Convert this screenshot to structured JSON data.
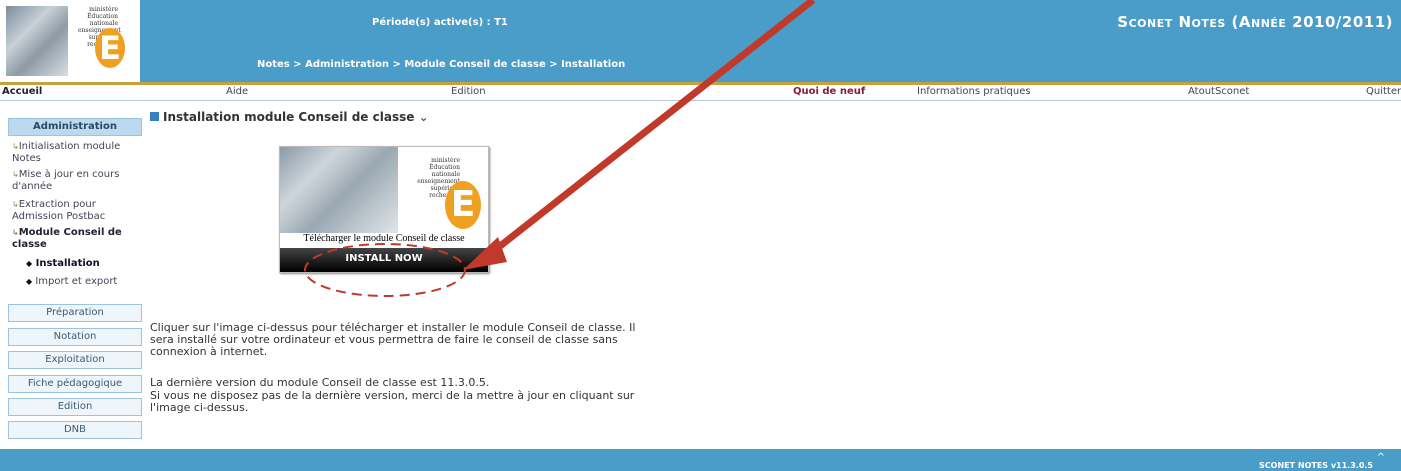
{
  "header": {
    "logo_lines": [
      "ministère",
      "Éducation",
      "nationale",
      "enseignement",
      "supérieur",
      "recherche"
    ],
    "logo_letter": "E",
    "periode": "Période(s) active(s) : T1",
    "breadcrumb": "Notes > Administration > Module Conseil de classe > Installation",
    "app_title": "Sconet Notes (Année 2010/2011)"
  },
  "menu": {
    "accueil": "Accueil",
    "aide": "Aide",
    "edition": "Edition",
    "quoi_de_neuf": "Quoi de neuf",
    "infos": "Informations pratiques",
    "atout": "AtoutSconet",
    "quitter": "Quitter"
  },
  "sidebar": {
    "administration": "Administration",
    "links": [
      "Initialisation module Notes",
      "Mise à jour en cours d'année",
      "Extraction pour Admission Postbac",
      "Module Conseil de classe"
    ],
    "sub": [
      "Installation",
      "Import et export"
    ],
    "sections": [
      "Préparation",
      "Notation",
      "Exploitation",
      "Fiche pédagogique",
      "Edition",
      "DNB"
    ]
  },
  "main": {
    "title": "Installation module Conseil de classe",
    "title_caret": "⌄",
    "download_label": "Télécharger le module Conseil de classe",
    "install_now": "INSTALL NOW",
    "para1": "Cliquer sur l'image ci-dessus pour télécharger et installer le module Conseil de classe. Il sera installé sur votre ordinateur et vous permettra de faire le conseil de classe sans connexion à internet.",
    "para2_line1": "La dernière version du module Conseil de classe est 11.3.0.5.",
    "para2_line2": "Si vous ne disposez pas de la dernière version, merci de la mettre à jour en cliquant sur l'image ci-dessus."
  },
  "footer": {
    "version": "SCONET NOTES v11.3.0.5",
    "caret": "^"
  },
  "colors": {
    "header_blue": "#4a9cc9",
    "menu_highlight": "#8b1a3a",
    "annotation_red": "#c0392b"
  }
}
